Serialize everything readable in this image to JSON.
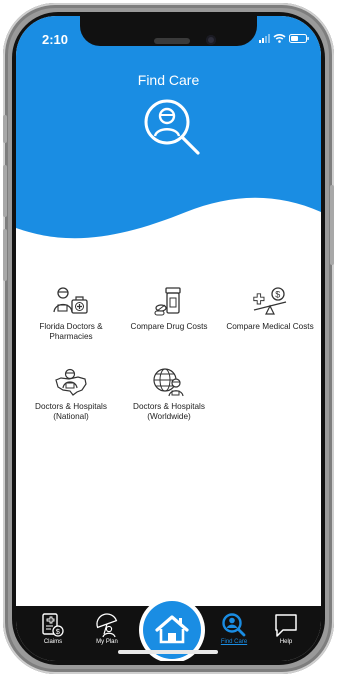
{
  "status": {
    "time": "2:10"
  },
  "header": {
    "title": "Find Care"
  },
  "colors": {
    "primary": "#1a8de3",
    "tabbar": "#111111",
    "active_tab": "#1a8de3"
  },
  "options": [
    {
      "label": "Florida Doctors & Pharmacies",
      "icon": "doctor-pharmacy-icon"
    },
    {
      "label": "Compare Drug Costs",
      "icon": "pill-bottle-icon"
    },
    {
      "label": "Compare Medical Costs",
      "icon": "scale-dollar-icon"
    },
    {
      "label": "Doctors & Hospitals (National)",
      "icon": "doctor-us-map-icon"
    },
    {
      "label": "Doctors & Hospitals (Worldwide)",
      "icon": "doctor-globe-icon"
    }
  ],
  "tabs": [
    {
      "label": "Claims",
      "icon": "claims-icon",
      "active": false
    },
    {
      "label": "My Plan",
      "icon": "umbrella-person-icon",
      "active": false
    },
    {
      "label": "Home",
      "icon": "house-icon",
      "active": false
    },
    {
      "label": "Find Care",
      "icon": "search-person-icon",
      "active": true
    },
    {
      "label": "Help",
      "icon": "chat-bubble-icon",
      "active": false
    }
  ]
}
